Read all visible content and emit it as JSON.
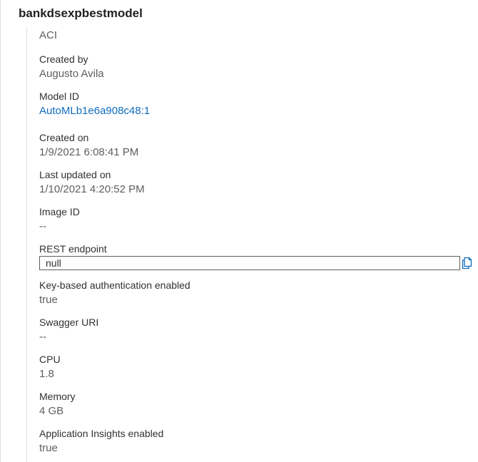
{
  "title": "bankdsexpbestmodel",
  "compute_type": "ACI",
  "fields": {
    "created_by": {
      "label": "Created by",
      "value": "Augusto Avila"
    },
    "model_id": {
      "label": "Model ID",
      "value": "AutoMLb1e6a908c48:1"
    },
    "created_on": {
      "label": "Created on",
      "value": "1/9/2021 6:08:41 PM"
    },
    "last_updated_on": {
      "label": "Last updated on",
      "value": "1/10/2021 4:20:52 PM"
    },
    "image_id": {
      "label": "Image ID",
      "value": "--"
    },
    "rest_endpoint": {
      "label": "REST endpoint",
      "value": "null"
    },
    "key_auth": {
      "label": "Key-based authentication enabled",
      "value": "true"
    },
    "swagger_uri": {
      "label": "Swagger URI",
      "value": "--"
    },
    "cpu": {
      "label": "CPU",
      "value": "1.8"
    },
    "memory": {
      "label": "Memory",
      "value": "4 GB"
    },
    "app_insights": {
      "label": "Application Insights enabled",
      "value": "true"
    }
  },
  "icons": {
    "copy": "copy-icon"
  },
  "colors": {
    "link": "#0f6cbd",
    "icon": "#0f6cbd"
  }
}
